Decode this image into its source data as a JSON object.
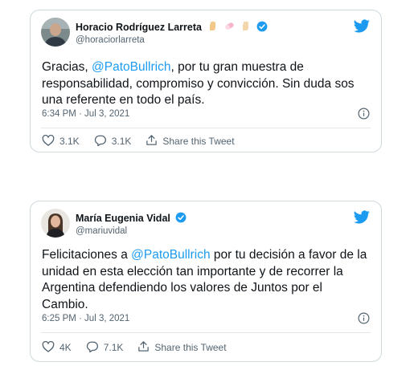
{
  "tweets": [
    {
      "author_name": "Horacio Rodríguez Larreta",
      "handle": "@horaciorlarreta",
      "verified": true,
      "text_parts": [
        "Gracias, ",
        "@PatoBullrich",
        ", por tu gran muestra de responsabilidad, compromiso y convicción. Sin duda sos una referente en todo el país."
      ],
      "timestamp": "6:34 PM · Jul 3, 2021",
      "likes": "3.1K",
      "replies": "3.1K",
      "share_label": "Share this Tweet"
    },
    {
      "author_name": "María Eugenia Vidal",
      "handle": "@mariuvidal",
      "verified": true,
      "text_parts": [
        "Felicitaciones a ",
        "@PatoBullrich",
        " por tu decisión a favor de la unidad en esta elección tan importante y de recorrer la Argentina defendiendo los valores de Juntos por el Cambio."
      ],
      "timestamp": "6:25 PM · Jul 3, 2021",
      "likes": "4K",
      "replies": "7.1K",
      "share_label": "Share this Tweet"
    }
  ],
  "colors": {
    "brand_blue": "#1d9bf0",
    "border": "#cfd9de",
    "secondary_text": "#536471"
  },
  "icons": [
    "avatar",
    "raised-hand-emoji",
    "pill-emoji",
    "verified-badge-icon",
    "twitter-bird-icon",
    "info-icon",
    "heart-icon",
    "reply-icon",
    "share-icon"
  ]
}
